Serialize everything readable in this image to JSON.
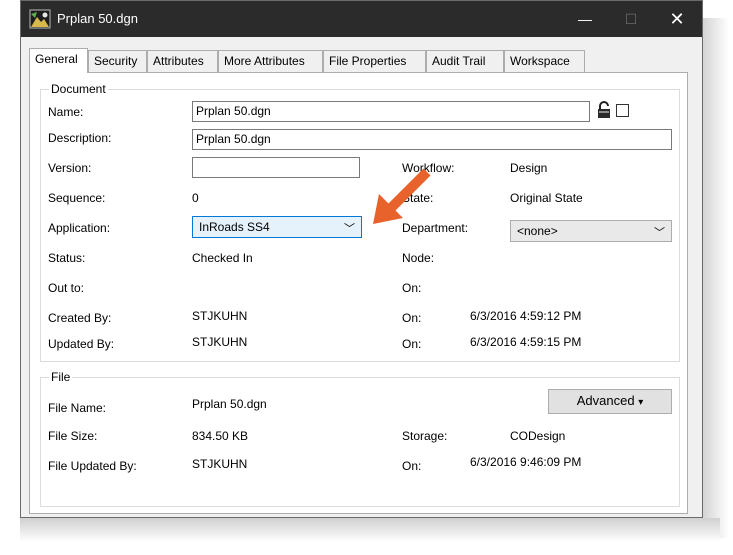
{
  "window": {
    "title": "Prplan 50.dgn",
    "minimize_glyph": "—",
    "maximize_glyph": "☐",
    "close_glyph": "✕"
  },
  "tabs": [
    "General",
    "Security",
    "Attributes",
    "More Attributes",
    "File Properties",
    "Audit Trail",
    "Workspace"
  ],
  "active_tab": "General",
  "document": {
    "group_title": "Document",
    "name_label": "Name:",
    "name_value": "Prplan 50.dgn",
    "description_label": "Description:",
    "description_value": "Prplan 50.dgn",
    "version_label": "Version:",
    "version_value": "",
    "workflow_label": "Workflow:",
    "workflow_value": "Design",
    "sequence_label": "Sequence:",
    "sequence_value": "0",
    "state_label": "State:",
    "state_value": "Original State",
    "application_label": "Application:",
    "application_value": "InRoads SS4",
    "department_label": "Department:",
    "department_value": "<none>",
    "status_label": "Status:",
    "status_value": "Checked In",
    "node_label": "Node:",
    "node_value": "",
    "outto_label": "Out to:",
    "outto_value": "",
    "outto_on_label": "On:",
    "outto_on_value": "",
    "created_label": "Created By:",
    "created_value": "STJKUHN",
    "created_on_label": "On:",
    "created_on_value": "6/3/2016 4:59:12 PM",
    "updated_label": "Updated By:",
    "updated_value": "STJKUHN",
    "updated_on_label": "On:",
    "updated_on_value": "6/3/2016 4:59:15 PM"
  },
  "file": {
    "group_title": "File",
    "advanced_label": "Advanced",
    "advanced_arrow": "▾",
    "filename_label": "File Name:",
    "filename_value": "Prplan 50.dgn",
    "filesize_label": "File Size:",
    "filesize_value": "834.50 KB",
    "storage_label": "Storage:",
    "storage_value": "CODesign",
    "fileupdated_label": "File Updated By:",
    "fileupdated_value": "STJKUHN",
    "fileupdated_on_label": "On:",
    "fileupdated_on_value": "6/3/2016 9:46:09 PM"
  },
  "icons": {
    "window": "document-icon",
    "lock": "lock-icon",
    "dropdown": "chevron-down-icon",
    "annotation": "orange-arrow-icon"
  },
  "colors": {
    "titlebar": "#2b2b2b",
    "combo_focus": "#0078d7",
    "annotation_arrow": "#e8622c"
  }
}
